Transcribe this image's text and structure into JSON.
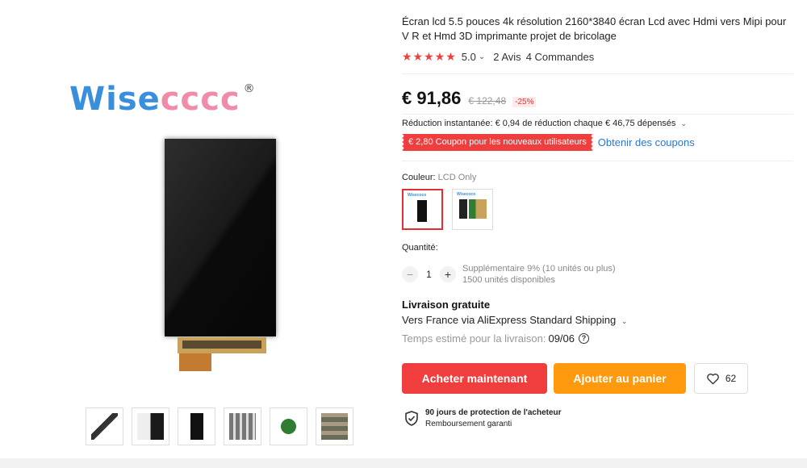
{
  "brand": {
    "logo_text_blue": "Wise",
    "logo_text_pink": "cccc",
    "registered": "®"
  },
  "product": {
    "title": "Écran lcd 5.5 pouces 4k résolution 2160*3840 écran Lcd avec Hdmi vers Mipi pour V R et Hmd 3D imprimante projet de bricolage",
    "stars": "★★★★★",
    "rating": "5.0",
    "reviews": "2 Avis",
    "orders": "4 Commandes"
  },
  "price": {
    "current": "€ 91,86",
    "original": "€ 122,48",
    "discount": "-25%"
  },
  "promo": {
    "reduction": "Réduction instantanée: € 0,94 de réduction chaque € 46,75 dépensés",
    "coupon": "€ 2,80 Coupon pour les nouveaux utilisateurs",
    "coupon_link": "Obtenir des coupons"
  },
  "variant": {
    "label": "Couleur: ",
    "selected": "LCD Only",
    "mini_logo": "Wisecoco"
  },
  "quantity": {
    "label": "Quantité:",
    "minus": "−",
    "value": "1",
    "plus": "+",
    "bulk": "Supplémentaire 9% (10 unités ou plus)",
    "available": "1500 unités disponibles"
  },
  "shipping": {
    "title": "Livraison gratuite",
    "method": "Vers France via AliExpress Standard Shipping",
    "estimate_label": "Temps estimé pour la livraison:",
    "date": "09/06",
    "help": "?"
  },
  "actions": {
    "buy": "Acheter maintenant",
    "cart": "Ajouter au panier",
    "wishlist_count": "62"
  },
  "protection": {
    "title": "90 jours de protection de l'acheteur",
    "subtitle": "Remboursement garanti"
  },
  "colors": {
    "accent_red": "#f03e3e",
    "accent_orange": "#ff9a0e",
    "link_blue": "#2878d7"
  },
  "icons": [
    "star-icon",
    "chevron-down-icon",
    "help-icon",
    "heart-icon",
    "shield-check-icon"
  ]
}
